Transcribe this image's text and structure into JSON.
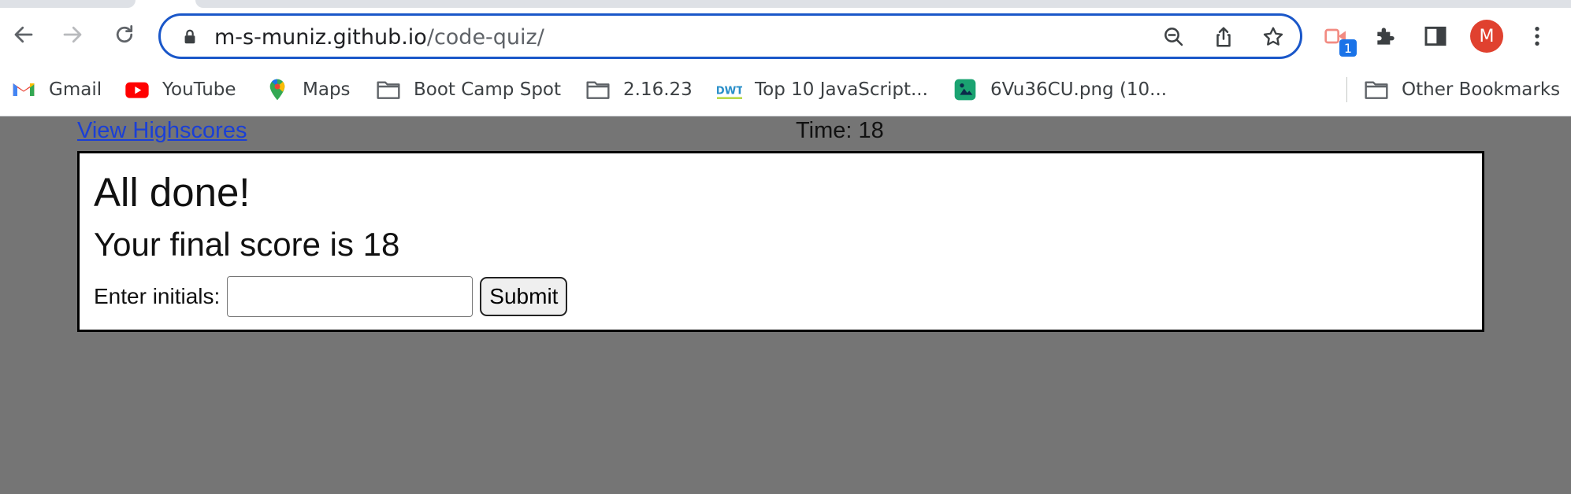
{
  "browser": {
    "url": {
      "host": "m-s-muniz.github.io",
      "path": "/code-quiz/"
    },
    "extension_badge": "1",
    "profile_initial": "M",
    "bookmarks": [
      {
        "label": "Gmail",
        "icon": "gmail-icon"
      },
      {
        "label": "YouTube",
        "icon": "youtube-icon"
      },
      {
        "label": "Maps",
        "icon": "maps-icon"
      },
      {
        "label": "Boot Camp Spot",
        "icon": "folder-icon"
      },
      {
        "label": "2.16.23",
        "icon": "folder-icon"
      },
      {
        "label": "Top 10 JavaScript...",
        "icon": "dwt-icon"
      },
      {
        "label": "6Vu36CU.png (10...",
        "icon": "image-icon"
      }
    ],
    "other_bookmarks": "Other Bookmarks",
    "colors": {
      "omnibox_border": "#1a57c9",
      "avatar": "#e0412f",
      "page_bg": "#757575"
    }
  },
  "page": {
    "highscores_link": "View Highscores",
    "timer_label": "Time:",
    "timer_value": "18",
    "title": "All done!",
    "score_text": "Your final score is 18",
    "initials_label": "Enter initials:",
    "initials_value": "",
    "submit_label": "Submit"
  }
}
